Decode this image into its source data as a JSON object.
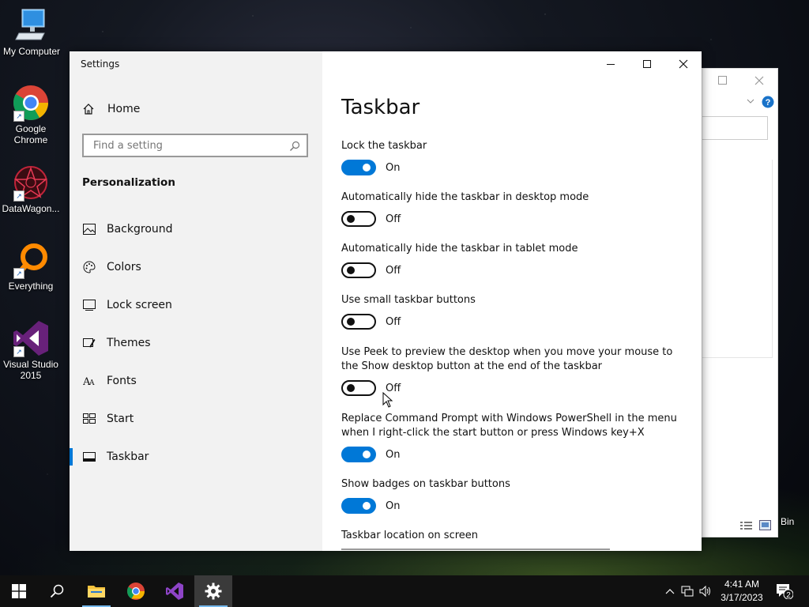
{
  "desktop": {
    "icons": [
      {
        "label": "My Computer",
        "icon": "computer-icon"
      },
      {
        "label": "Google Chrome",
        "icon": "chrome-icon"
      },
      {
        "label": "DataWagon...",
        "icon": "datawagon-icon"
      },
      {
        "label": "Everything",
        "icon": "everything-icon"
      },
      {
        "label": "Visual Studio 2015",
        "icon": "visual-studio-icon"
      }
    ],
    "recycle_bin_label": "Bin"
  },
  "settings_window": {
    "title": "Settings",
    "home_label": "Home",
    "search_placeholder": "Find a setting",
    "section_title": "Personalization",
    "nav_items": [
      {
        "label": "Background",
        "icon": "picture-icon"
      },
      {
        "label": "Colors",
        "icon": "palette-icon"
      },
      {
        "label": "Lock screen",
        "icon": "lock-screen-icon"
      },
      {
        "label": "Themes",
        "icon": "themes-icon"
      },
      {
        "label": "Fonts",
        "icon": "fonts-icon"
      },
      {
        "label": "Start",
        "icon": "start-icon"
      },
      {
        "label": "Taskbar",
        "icon": "taskbar-icon",
        "active": true
      }
    ],
    "page_title": "Taskbar",
    "options": [
      {
        "label": "Lock the taskbar",
        "state": "On"
      },
      {
        "label": "Automatically hide the taskbar in desktop mode",
        "state": "Off"
      },
      {
        "label": "Automatically hide the taskbar in tablet mode",
        "state": "Off"
      },
      {
        "label": "Use small taskbar buttons",
        "state": "Off"
      },
      {
        "label": "Use Peek to preview the desktop when you move your mouse to the Show desktop button at the end of the taskbar",
        "state": "Off"
      },
      {
        "label": "Replace Command Prompt with Windows PowerShell in the menu when I right-click the start button or press Windows key+X",
        "state": "On"
      },
      {
        "label": "Show badges on taskbar buttons",
        "state": "On"
      }
    ],
    "location_label": "Taskbar location on screen"
  },
  "taskbar": {
    "time": "4:41 AM",
    "date": "3/17/2023",
    "notification_count": "2"
  },
  "colors": {
    "accent": "#0078d7",
    "sidebar_bg": "#f2f2f2",
    "taskbar_bg": "#101010"
  }
}
